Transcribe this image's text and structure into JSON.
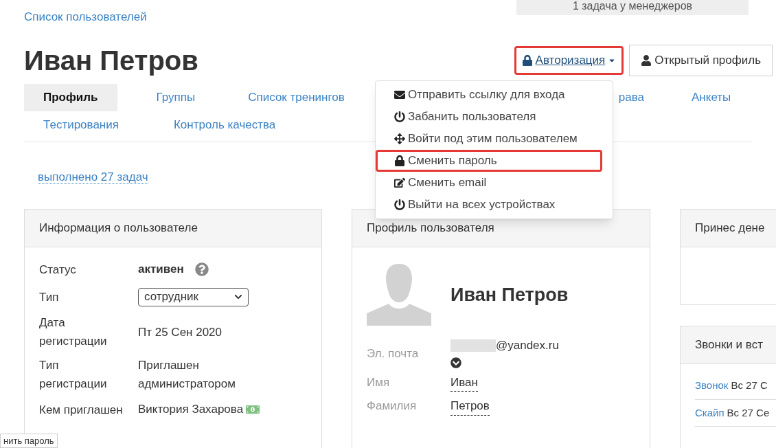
{
  "breadcrumb": "Список пользователей",
  "manager_tasks": "1 задача у менеджеров",
  "title": "Иван Петров",
  "auth_button": {
    "label": "Авторизация",
    "highlighted": true
  },
  "public_profile_button": "Открытый профиль",
  "tabs": [
    [
      {
        "label": "Профиль",
        "selected": true
      },
      {
        "label": "Группы",
        "selected": false
      },
      {
        "label": "Список тренингов",
        "selected": false
      },
      {
        "label": "рава",
        "selected": false
      },
      {
        "label": "Анкеты",
        "selected": false
      }
    ],
    [
      {
        "label": "Тестирования",
        "selected": false
      },
      {
        "label": "Контроль качества",
        "selected": false
      }
    ]
  ],
  "auth_menu": [
    {
      "kind": "mail",
      "label": "Отправить ссылку для входа",
      "highlighted": false
    },
    {
      "kind": "power",
      "label": "Забанить пользователя",
      "highlighted": false
    },
    {
      "kind": "move",
      "label": "Войти под этим пользователем",
      "highlighted": false
    },
    {
      "kind": "lock",
      "label": "Сменить пароль",
      "highlighted": true
    },
    {
      "kind": "edit",
      "label": "Сменить email",
      "highlighted": false
    },
    {
      "kind": "power",
      "label": "Выйти на всех устройствах",
      "highlighted": false
    }
  ],
  "tasks_done": "выполнено 27 задач",
  "user_info": {
    "title": "Информация о пользователе",
    "rows": [
      {
        "kind": "status",
        "label": "Статус",
        "value": "активен"
      },
      {
        "kind": "select",
        "label": "Тип",
        "value": "сотрудник"
      },
      {
        "kind": "text",
        "label": "Дата регистрации",
        "value": "Пт 25 Сен 2020"
      },
      {
        "kind": "text",
        "label": "Тип регистрации",
        "value": "Приглашен администратором"
      },
      {
        "kind": "money",
        "label": "Кем приглашен",
        "value": "Виктория Захарова"
      }
    ]
  },
  "profile": {
    "title": "Профиль пользователя",
    "name": "Иван Петров",
    "fields": [
      {
        "kind": "email",
        "label": "Эл. почта",
        "value": "@yandex.ru"
      },
      {
        "kind": "editable",
        "label": "Имя",
        "value": "Иван"
      },
      {
        "kind": "editable",
        "label": "Фамилия",
        "value": "Петров"
      }
    ]
  },
  "money_card": {
    "title": "Принес дене"
  },
  "calls_card": {
    "title": "Звонки и вст",
    "items": [
      {
        "link": "Звонок",
        "date": "Вс 27 С"
      },
      {
        "link": "Скайп",
        "date": "Вс 27 Се"
      }
    ]
  },
  "status_bar": "нить пароль"
}
